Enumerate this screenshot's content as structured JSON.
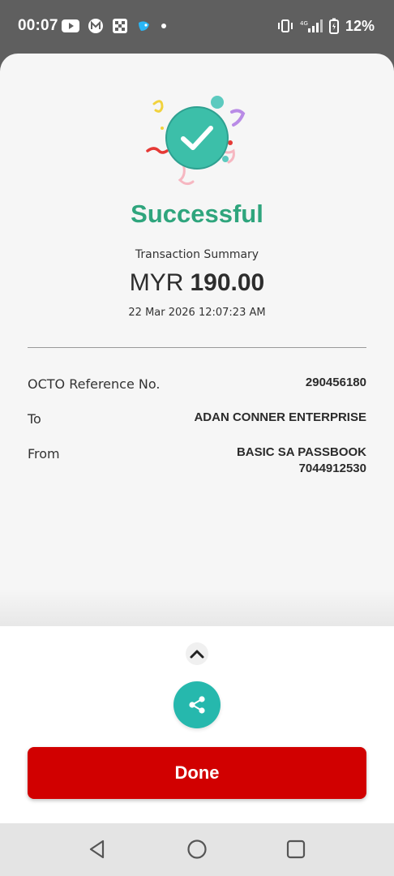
{
  "status_bar": {
    "time": "00:07",
    "battery_percent": "12%",
    "left_icons": [
      "youtube-icon",
      "m-app-icon",
      "grid-app-icon",
      "bird-app-icon",
      "dot-icon"
    ],
    "right_icons": [
      "vibrate-icon",
      "signal-4g-icon",
      "battery-charging-icon"
    ]
  },
  "result": {
    "title": "Successful",
    "title_color": "#2fa57d",
    "summary_label": "Transaction Summary",
    "currency": "MYR",
    "amount": "190.00",
    "timestamp": "22 Mar 2026 12:07:23 AM"
  },
  "details": [
    {
      "label": "OCTO Reference No.",
      "value": "290456180"
    },
    {
      "label": "To",
      "value": "ADAN CONNER ENTERPRISE"
    },
    {
      "label": "From",
      "value": "BASIC SA PASSBOOK",
      "value2": "7044912530"
    }
  ],
  "actions": {
    "expand_icon": "chevron-up-icon",
    "share_icon": "share-icon",
    "share_color": "#26b8ad",
    "done_label": "Done",
    "done_color": "#d10000"
  },
  "nav_bar": {
    "buttons": [
      "back-icon",
      "home-icon",
      "recents-icon"
    ]
  }
}
